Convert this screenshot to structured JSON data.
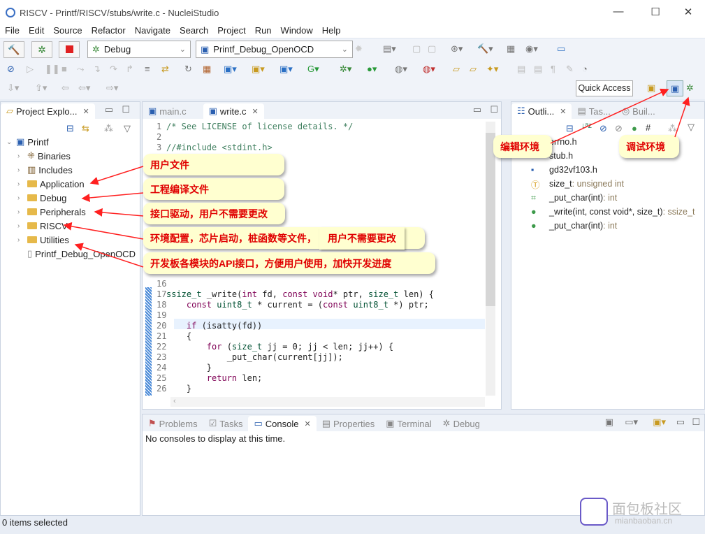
{
  "window": {
    "title": "RISCV - Printf/RISCV/stubs/write.c - NucleiStudio",
    "controls": [
      "—",
      "☐",
      "✕"
    ]
  },
  "menu": [
    "File",
    "Edit",
    "Source",
    "Refactor",
    "Navigate",
    "Search",
    "Project",
    "Run",
    "Window",
    "Help"
  ],
  "toolbar": {
    "build_mode": "Debug",
    "launch_config": "Printf_Debug_OpenOCD",
    "quick_access": "Quick Access"
  },
  "project_explorer": {
    "tab": "Project Explo...",
    "root": "Printf",
    "items": [
      "Binaries",
      "Includes",
      "Application",
      "Debug",
      "Peripherals",
      "RISCV",
      "Utilities",
      "Printf_Debug_OpenOCD"
    ]
  },
  "editor": {
    "tabs": [
      "main.c",
      "write.c"
    ],
    "lines": [
      {
        "n": "1",
        "code": "/* See LICENSE of license details. */"
      },
      {
        "n": "2",
        "code": ""
      },
      {
        "n": "3",
        "code": "//#include <stdint.h>"
      },
      {
        "n": "16",
        "code": ""
      },
      {
        "n": "17",
        "code": "ssize_t _write(int fd, const void* ptr, size_t len) {"
      },
      {
        "n": "18",
        "code": "    const uint8_t * current = (const uint8_t *) ptr;"
      },
      {
        "n": "19",
        "code": ""
      },
      {
        "n": "20",
        "code": "    if (isatty(fd))"
      },
      {
        "n": "21",
        "code": "    {"
      },
      {
        "n": "22",
        "code": "        for (size_t jj = 0; jj < len; jj++) {"
      },
      {
        "n": "23",
        "code": "            _put_char(current[jj]);"
      },
      {
        "n": "24",
        "code": "        }"
      },
      {
        "n": "25",
        "code": "        return len;"
      },
      {
        "n": "26",
        "code": "    }"
      }
    ]
  },
  "outline": {
    "tabs": [
      "Outli...",
      "Tas...",
      "Buil..."
    ],
    "items": [
      {
        "name": "errno.h",
        "type": ""
      },
      {
        "name": "stub.h",
        "type": ""
      },
      {
        "name": "gd32vf103.h",
        "type": ""
      },
      {
        "name": "size_t",
        "type": " : unsigned int"
      },
      {
        "name": "_put_char(int)",
        "type": " : int"
      },
      {
        "name": "_write(int, const void*, size_t)",
        "type": " : ssize_t"
      },
      {
        "name": "_put_char(int)",
        "type": " : int"
      }
    ]
  },
  "console": {
    "tabs": [
      "Problems",
      "Tasks",
      "Console",
      "Properties",
      "Terminal",
      "Debug"
    ],
    "message": "No consoles to display at this time."
  },
  "status": "0 items selected",
  "annotations": {
    "user_files": "用户文件",
    "build_files": "工程编译文件",
    "drivers": "接口驱动，用户不需要更改",
    "riscv": "环境配置，芯片启动，桩函数等文件，",
    "riscv_note": "用户不需要更改",
    "utilities": "开发板各模块的API接口，方便用户使用，加快开发进度",
    "edit_env": "编辑环境",
    "debug_env": "调试环境"
  },
  "watermark": {
    "text": "面包板社区",
    "url_text": "mianbaoban.cn"
  },
  "colors": {
    "callout_bg": "#ffffd0",
    "callout_text": "#e00000",
    "arrow": "#ff2020"
  }
}
